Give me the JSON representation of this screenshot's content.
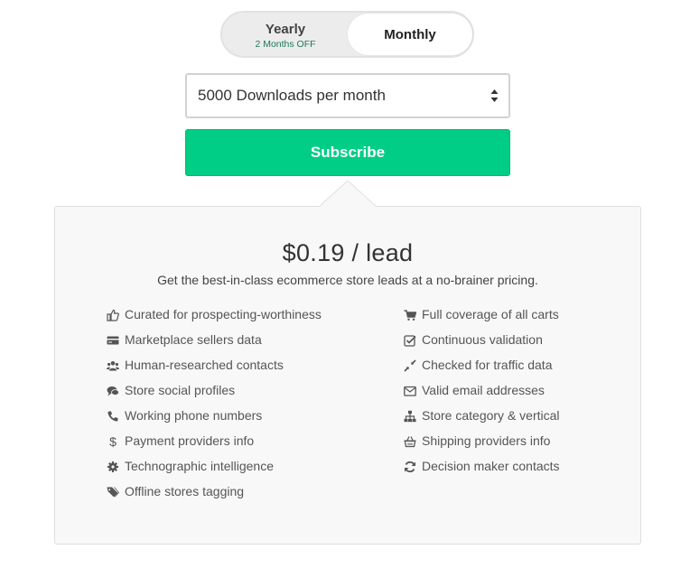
{
  "billing_toggle": {
    "yearly_label": "Yearly",
    "yearly_note": "2 Months OFF",
    "monthly_label": "Monthly",
    "selected": "Monthly"
  },
  "plan_select": {
    "value": "5000 Downloads per month"
  },
  "subscribe_label": "Subscribe",
  "pricing": {
    "price": "$0.19 / lead",
    "subtitle": "Get the best-in-class ecommerce store leads at a no-brainer pricing."
  },
  "features_left": [
    {
      "label": "Curated for prospecting-worthiness",
      "icon": "thumbs-up-icon"
    },
    {
      "label": "Marketplace sellers data",
      "icon": "credit-card-icon"
    },
    {
      "label": "Human-researched contacts",
      "icon": "users-icon"
    },
    {
      "label": "Store social profiles",
      "icon": "comments-icon"
    },
    {
      "label": "Working phone numbers",
      "icon": "phone-icon"
    },
    {
      "label": "Payment providers info",
      "icon": "dollar-icon"
    },
    {
      "label": "Technographic intelligence",
      "icon": "gear-icon"
    },
    {
      "label": "Offline stores tagging",
      "icon": "tags-icon"
    }
  ],
  "features_right": [
    {
      "label": "Full coverage of all carts",
      "icon": "cart-icon"
    },
    {
      "label": "Continuous validation",
      "icon": "check-square-icon"
    },
    {
      "label": "Checked for traffic data",
      "icon": "compress-icon"
    },
    {
      "label": "Valid email addresses",
      "icon": "envelope-icon"
    },
    {
      "label": "Store category & vertical",
      "icon": "sitemap-icon"
    },
    {
      "label": "Shipping providers info",
      "icon": "basket-icon"
    },
    {
      "label": "Decision maker contacts",
      "icon": "refresh-icon"
    }
  ]
}
